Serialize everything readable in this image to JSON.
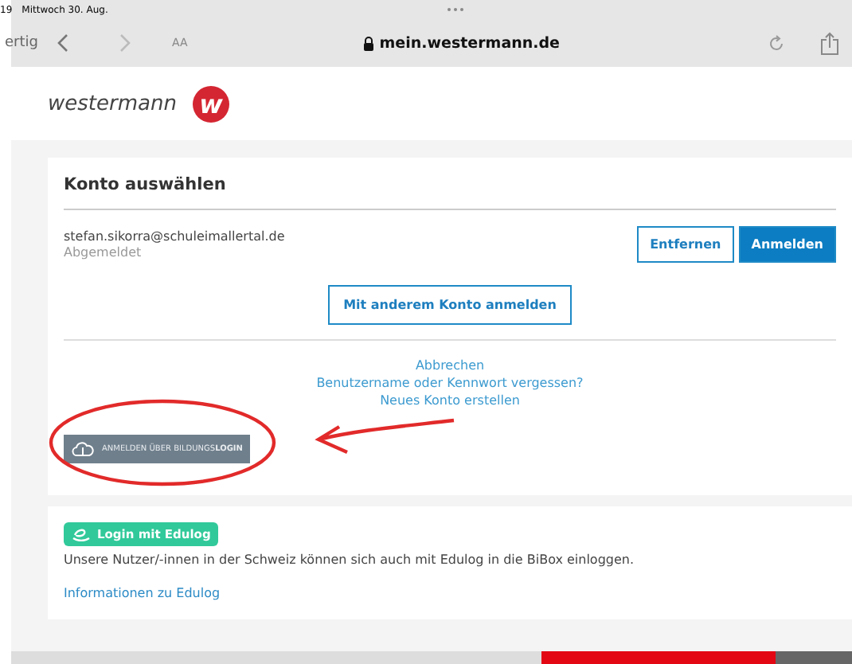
{
  "status_bar": {
    "time": "19",
    "date": "Mittwoch 30. Aug."
  },
  "browser": {
    "done": "ertig",
    "text_size": "AA",
    "url": "mein.westermann.de"
  },
  "brand": {
    "name": "westermann",
    "logo_letter": "w"
  },
  "account_card": {
    "title": "Konto auswählen",
    "accounts": [
      {
        "email": "stefan.sikorra@schuleimallertal.de",
        "status": "Abgemeldet",
        "buttons": [
          {
            "label": "Entfernen",
            "kind": "outline"
          },
          {
            "label": "Anmelden",
            "kind": "primary"
          }
        ]
      }
    ],
    "other_account_button": "Mit anderem Konto anmelden",
    "links": [
      "Abbrechen",
      "Benutzername oder Kennwort vergessen?",
      "Neues Konto erstellen"
    ],
    "bildungslogin_button": "ANMELDEN ÜBER BILDUNGS**LOGIN**"
  },
  "edulog_card": {
    "badge": "Login mit Edulog",
    "text": "Unsere Nutzer/-innen in der Schweiz können sich auch mit Edulog in die BiBox einloggen.",
    "link": "Informationen zu Edulog"
  }
}
